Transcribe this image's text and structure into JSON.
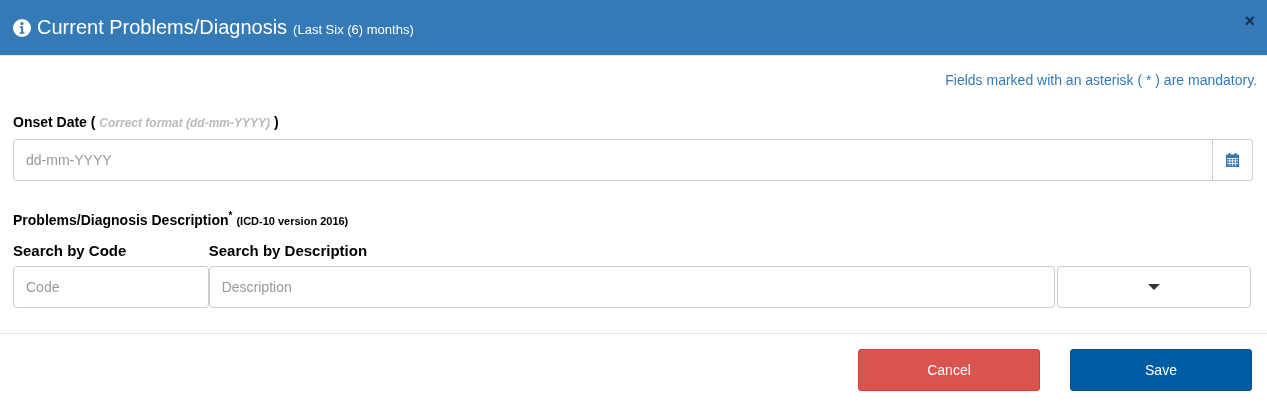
{
  "dialog": {
    "title": "Current Problems/Diagnosis",
    "subtitle": "(Last Six (6) months)",
    "close": "×"
  },
  "mandatory_note": "Fields marked with an asterisk ( * ) are mandatory.",
  "onset_date": {
    "label": "Onset Date ( *Correct format (dd-mm-YYYY)* )",
    "placeholder": "dd-mm-YYYY"
  },
  "diagnosis": {
    "label": "Problems/Diagnosis Description$^{*}$",
    "note": "(ICD-10 version 2016)",
    "code": {
      "label": "Search by Code",
      "placeholder": "Code"
    },
    "description": {
      "label": "Search by Description",
      "placeholder": "Description"
    }
  },
  "buttons": [
    {
      "label": "Cancel",
      "kind": "danger"
    },
    {
      "label": "Save",
      "kind": "primary"
    }
  ]
}
